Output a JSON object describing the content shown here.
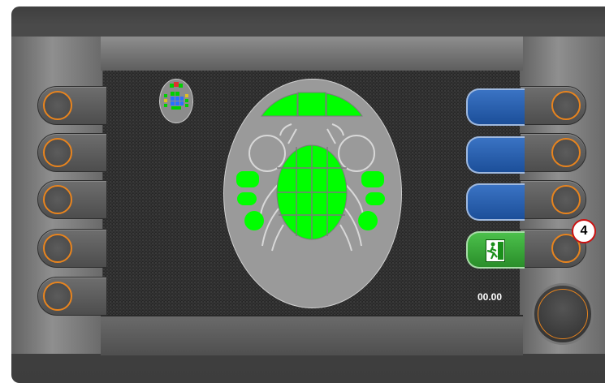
{
  "status": {
    "timer": "00.00"
  },
  "badge": {
    "number": "4"
  },
  "left_softkeys": [
    "softkey-1",
    "softkey-2",
    "softkey-3",
    "softkey-4",
    "softkey-5"
  ],
  "right_softkeys": [
    "softkey-1",
    "softkey-2",
    "softkey-3",
    "softkey-4"
  ],
  "function_buttons": [
    {
      "name": "function-button-1",
      "color": "#2a64b4"
    },
    {
      "name": "function-button-2",
      "color": "#2a64b4"
    },
    {
      "name": "function-button-3",
      "color": "#2a64b4"
    },
    {
      "name": "exit-button",
      "color": "#3aaa3a",
      "icon": "running-man-exit-icon"
    }
  ],
  "colors": {
    "accent_ring": "#e8841e",
    "segment_active": "#00ff00",
    "frame_dark": "#3d3d3d"
  },
  "diagram": {
    "icon": "beetle-zone-map",
    "segment_color": "#00ff00"
  }
}
